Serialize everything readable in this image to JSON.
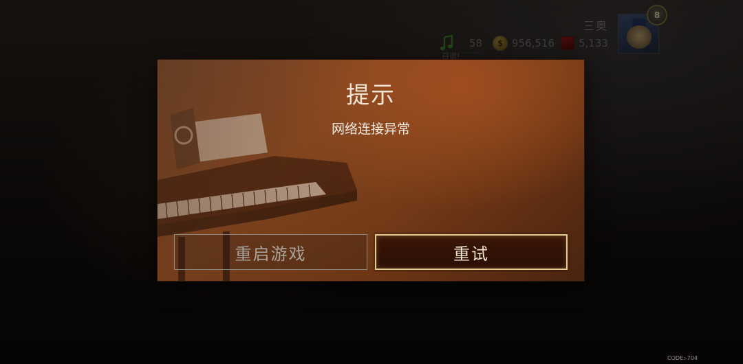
{
  "hud": {
    "username": "三奥",
    "level": "8",
    "notes_count": "58",
    "coins": "956,516",
    "gems": "5,133",
    "notes_tag": "日谱!"
  },
  "icons": {
    "notes": "music-note-icon",
    "coins": "coin-icon",
    "gems": "gem-icon"
  },
  "dialog": {
    "title": "提示",
    "message": "网络连接异常",
    "restart_button": "重启游戏",
    "retry_button": "重试"
  },
  "footer": {
    "code": "CODE:-704"
  },
  "colors": {
    "dialog_accent": "#8a4a22",
    "retry_border": "#e3cc8c"
  }
}
